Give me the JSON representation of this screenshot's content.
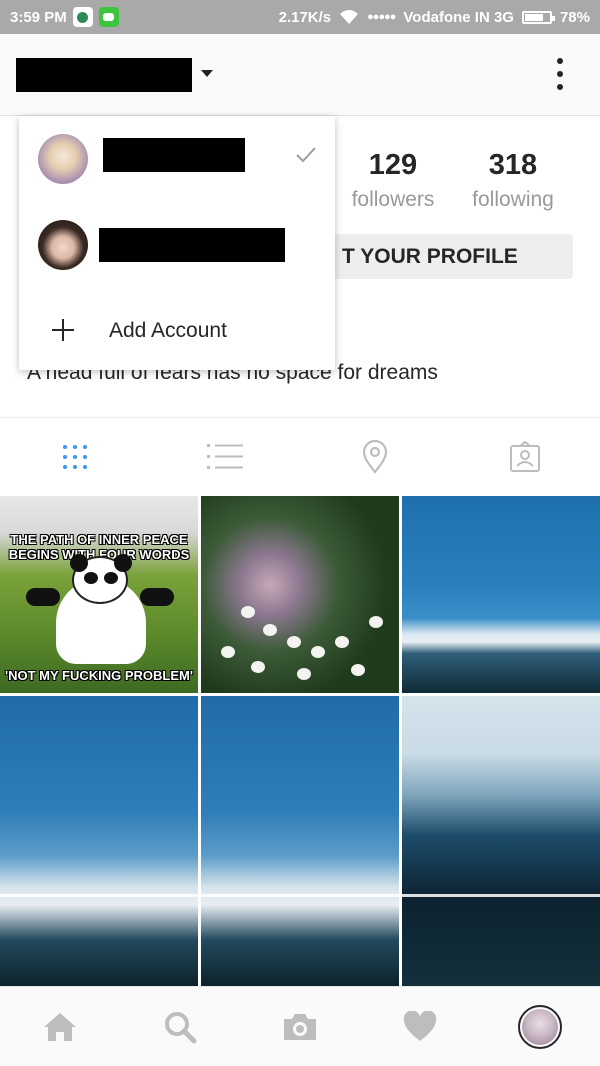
{
  "status_bar": {
    "time": "3:59 PM",
    "network_speed": "2.17K/s",
    "signal": "●●●●●",
    "carrier": "Vodafone IN 3G",
    "battery": "78%"
  },
  "profile": {
    "followers_count": "129",
    "followers_label": "followers",
    "following_count": "318",
    "following_label": "following",
    "edit_button_label": "T YOUR PROFILE",
    "bio": "A head full of fears has no space for dreams"
  },
  "account_switcher": {
    "add_account_label": "Add Account"
  },
  "grid": {
    "meme_top": "THE PATH OF INNER PEACE BEGINS WITH FOUR WORDS",
    "meme_bottom": "'NOT MY FUCKING PROBLEM'"
  },
  "tabs": [
    "grid-icon",
    "list-icon",
    "location-pin-icon",
    "tagged-icon"
  ],
  "bottom_nav": [
    "home-icon",
    "search-icon",
    "camera-icon",
    "heart-icon",
    "profile-avatar"
  ],
  "colors": {
    "active_tab": "#3897f0",
    "inactive_icon": "#bdbdbd",
    "status_bar": "#a9a9a9"
  }
}
